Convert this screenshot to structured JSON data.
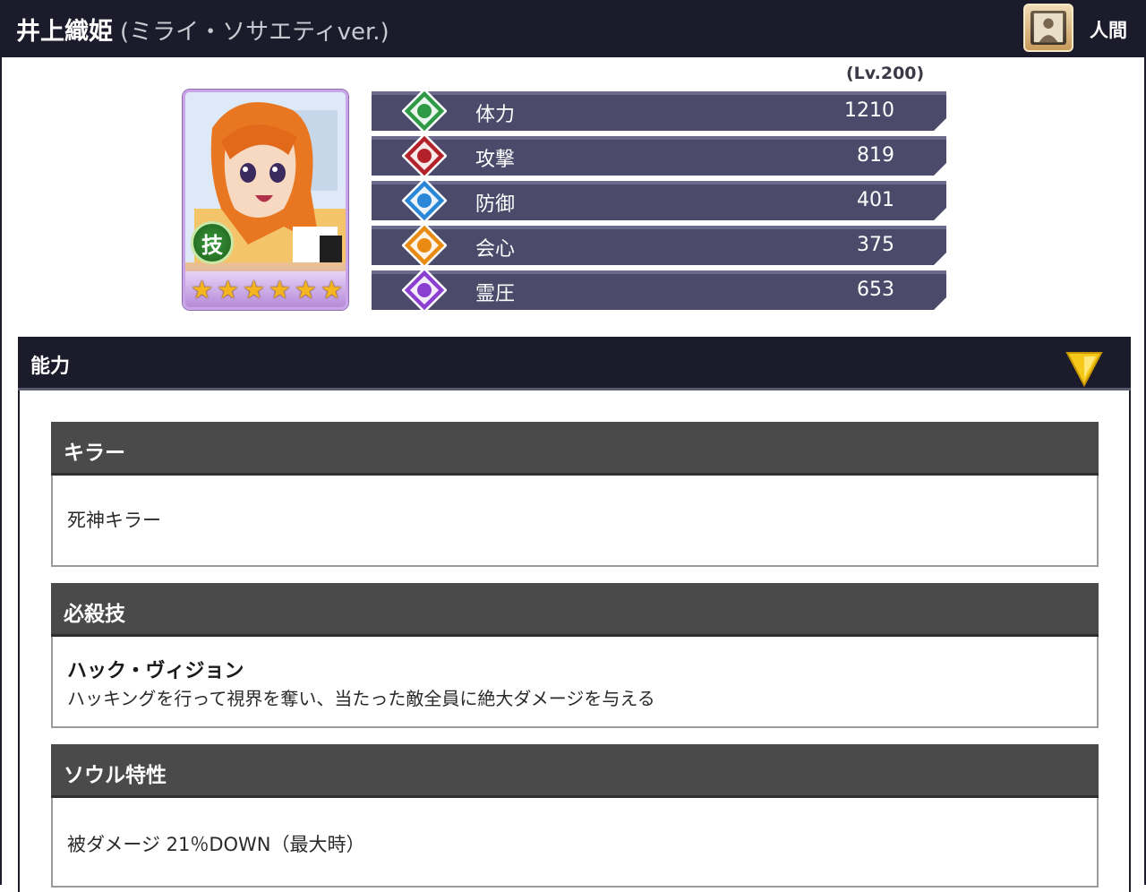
{
  "header": {
    "name": "井上織姫",
    "version": "(ミライ・ソサエティver.)",
    "type_label": "人間",
    "type_icon": "human-portrait-icon"
  },
  "level": "(Lv.200)",
  "card": {
    "skill_badge": "技",
    "stars": 6
  },
  "stats": [
    {
      "label": "体力",
      "value": "1210",
      "icon": "hp-icon",
      "color": "#2e9a46"
    },
    {
      "label": "攻撃",
      "value": "819",
      "icon": "attack-icon",
      "color": "#b3222a"
    },
    {
      "label": "防御",
      "value": "401",
      "icon": "defense-icon",
      "color": "#2a86d6"
    },
    {
      "label": "会心",
      "value": "375",
      "icon": "critical-icon",
      "color": "#e98a12"
    },
    {
      "label": "霊圧",
      "value": "653",
      "icon": "reiatsu-icon",
      "color": "#8a3fd0"
    }
  ],
  "ability": {
    "title": "能力",
    "sections": [
      {
        "heading": "キラー",
        "lines": [
          "死神キラー"
        ]
      },
      {
        "heading": "必殺技",
        "name": "ハック・ヴィジョン",
        "lines": [
          "ハッキングを行って視界を奪い、当たった敵全員に絶大ダメージを与える"
        ]
      },
      {
        "heading": "ソウル特性",
        "lines": [
          "被ダメージ 21％DOWN（最大時）"
        ]
      }
    ]
  }
}
